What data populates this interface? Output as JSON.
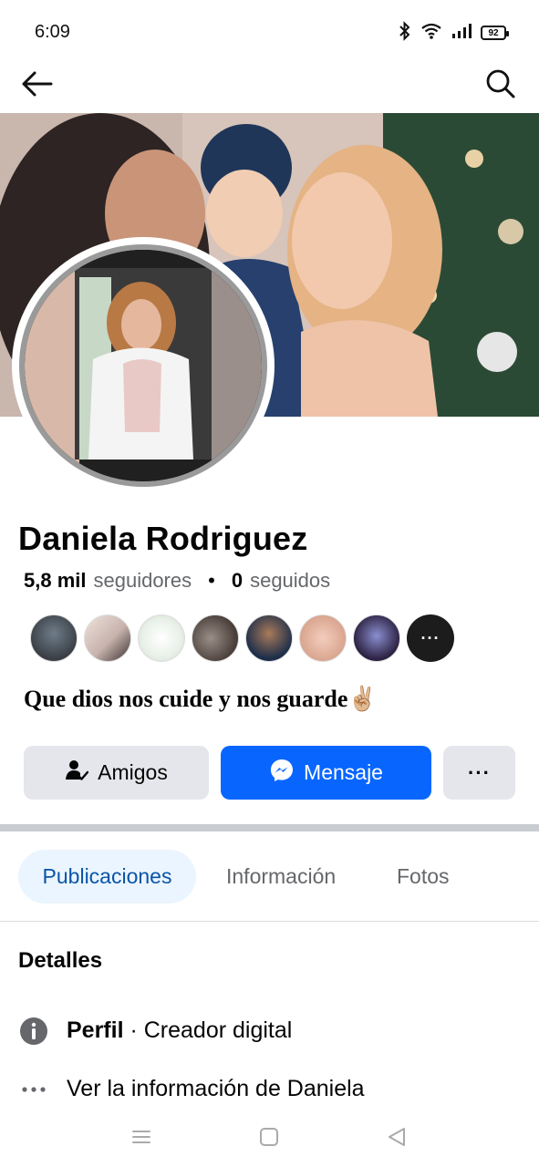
{
  "status_bar": {
    "time": "6:09",
    "battery": "92",
    "icons": [
      "bluetooth-icon",
      "wifi-icon",
      "signal-icon",
      "battery-icon"
    ]
  },
  "top_nav": {
    "icons": [
      "back-arrow-icon",
      "search-icon"
    ]
  },
  "profile": {
    "name": "Daniela Rodriguez",
    "followers_count": "5,8 mil",
    "followers_label": "seguidores",
    "following_count": "0",
    "following_label": "seguidos",
    "bio": "Que dios nos cuide y nos guarde",
    "bio_emoji": "✌🏼"
  },
  "friends_preview": {
    "count_shown": 8,
    "more_label": "···"
  },
  "actions": {
    "friends_label": "Amigos",
    "message_label": "Mensaje",
    "more_label": "···"
  },
  "tabs": {
    "posts": "Publicaciones",
    "info": "Información",
    "photos": "Fotos",
    "active": "Publicaciones"
  },
  "details": {
    "title": "Detalles",
    "profile_label": "Perfil",
    "profile_separator": " · ",
    "profile_category": "Creador digital",
    "see_info": "Ver la información de Daniela"
  },
  "colors": {
    "primary_blue": "#0866ff",
    "button_gray": "#e4e6eb",
    "active_tab_bg": "#ebf5ff",
    "active_tab_text": "#0a55a6",
    "secondary_text": "#65676b"
  }
}
